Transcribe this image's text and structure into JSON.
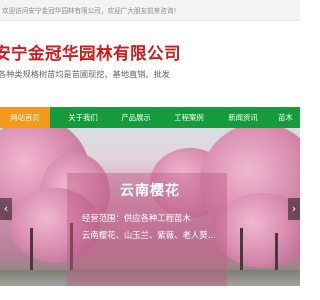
{
  "topbar": {
    "welcome": "欢迎访问安宁金冠华园林有限公司，欢迎广大朋友前来咨询！"
  },
  "header": {
    "company_name": "安宁金冠华园林有限公司",
    "slogan": "各种类规格树苗均是苗圃现挖、基地直销、批发"
  },
  "nav": {
    "items": [
      "网站首页",
      "关于我们",
      "产品展示",
      "工程案例",
      "新闻资讯",
      "苗木"
    ]
  },
  "banner": {
    "title": "云南樱花",
    "line1": "经营范围：供应各种工程苗木",
    "line2": "云南樱花、山玉兰、紫薇、老人葵…",
    "prev_arrow": "‹",
    "next_arrow": "›"
  }
}
